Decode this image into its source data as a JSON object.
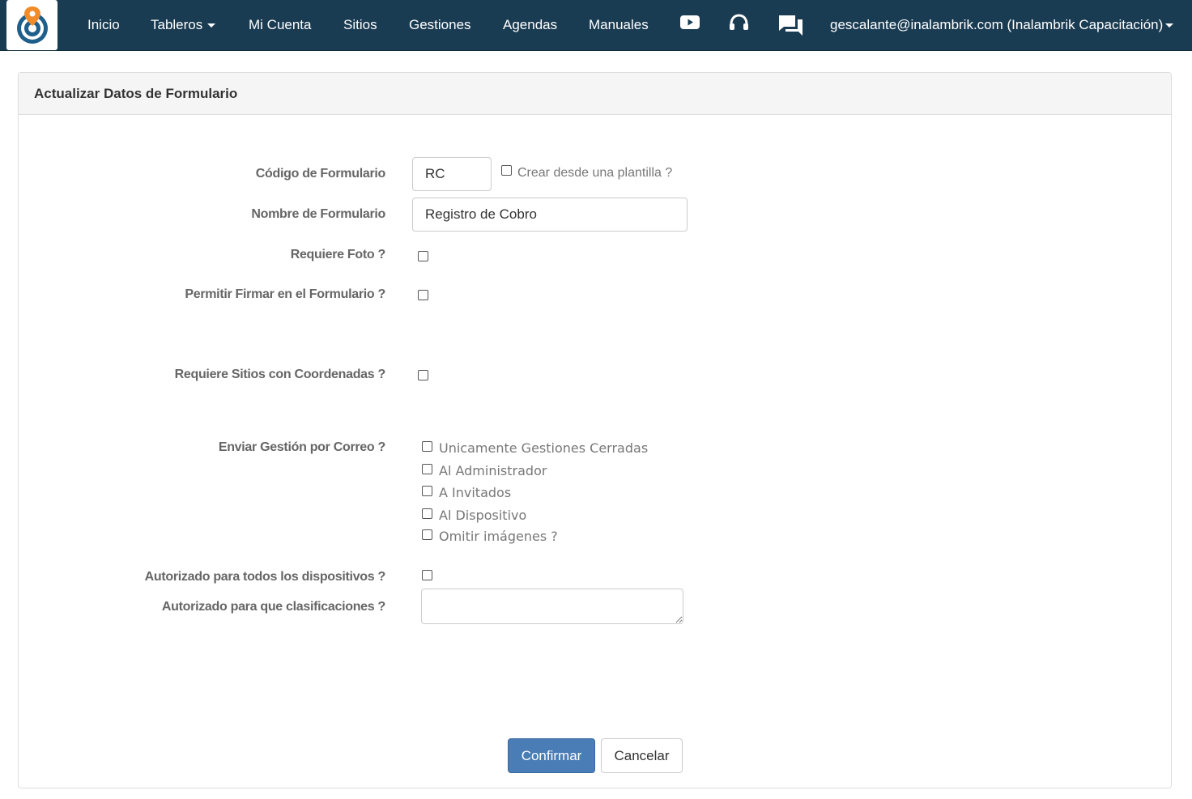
{
  "nav": {
    "logo_alt": "Inalambrik",
    "items": [
      {
        "label": "Inicio"
      },
      {
        "label": "Tableros"
      },
      {
        "label": "Mi Cuenta"
      },
      {
        "label": "Sitios"
      },
      {
        "label": "Gestiones"
      },
      {
        "label": "Agendas"
      },
      {
        "label": "Manuales"
      }
    ],
    "icons": [
      "youtube-icon",
      "headset-icon",
      "chat-icon"
    ],
    "user": "gescalante@inalambrik.com (Inalambrik Capacitación)"
  },
  "panel": {
    "title": "Actualizar Datos de Formulario"
  },
  "form": {
    "codigo_label": "Código de Formulario",
    "codigo_value": "RC",
    "plantilla_label": "Crear desde una plantilla ?",
    "nombre_label": "Nombre de Formulario",
    "nombre_value": "Registro de Cobro",
    "foto_label": "Requiere Foto ?",
    "firmar_label": "Permitir Firmar en el Formulario ?",
    "coordenadas_label": "Requiere Sitios con Coordenadas ?",
    "correo_label": "Enviar Gestión por Correo ?",
    "correo_options": [
      "Unicamente Gestiones Cerradas",
      "Al Administrador",
      "A Invitados",
      "Al Dispositivo",
      "Omitir imágenes ?"
    ],
    "dispositivos_label": "Autorizado para todos los dispositivos ?",
    "clasificaciones_label": "Autorizado para que clasificaciones ?",
    "clasificaciones_value": ""
  },
  "buttons": {
    "confirm": "Confirmar",
    "cancel": "Cancelar"
  },
  "colors": {
    "navbar": "#1a3c53",
    "primary": "#4a7cb6",
    "logo_orange": "#f28c28",
    "logo_blue": "#1e5f8c"
  }
}
